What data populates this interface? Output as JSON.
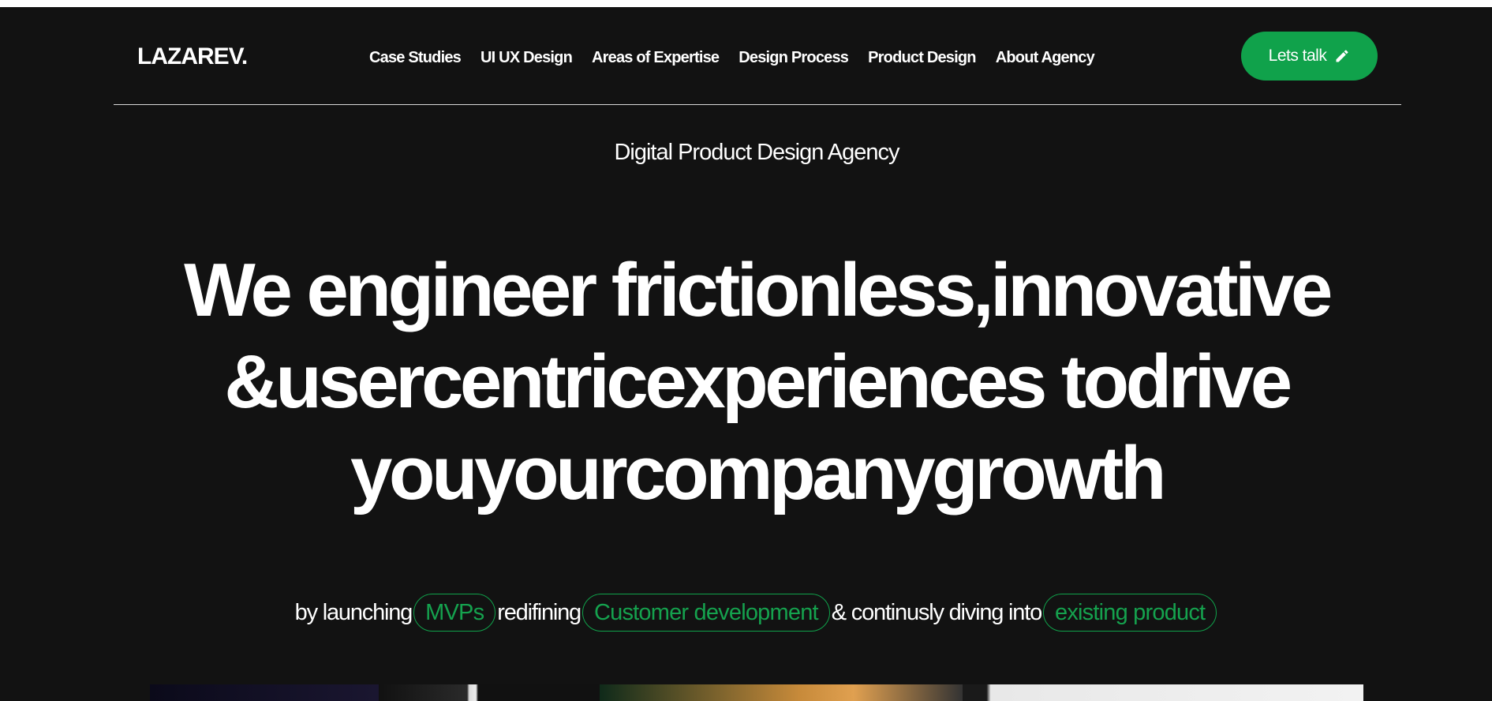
{
  "header": {
    "logo": "LAZAREV.",
    "nav": [
      {
        "label": "Case Studies"
      },
      {
        "label": "UI UX Design"
      },
      {
        "label": "Areas of Expertise"
      },
      {
        "label": "Design Process"
      },
      {
        "label": "Product Design"
      },
      {
        "label": "About Agency"
      }
    ],
    "cta_label": "Lets talk",
    "cta_icon": "pencil-icon",
    "accent_color": "#10a24b"
  },
  "hero": {
    "subtitle": "Digital Product Design Agency",
    "headline_lines": [
      "We engineer frictionless,innovative",
      "&usercentricexperiences todrive",
      "youyourcompanygrowth"
    ],
    "tagline": {
      "part1": "by launching",
      "pill1": "MVPs",
      "part2": "redifining",
      "pill2": "Customer development",
      "part3": "& continusly diving into",
      "pill3": "existing product"
    }
  }
}
